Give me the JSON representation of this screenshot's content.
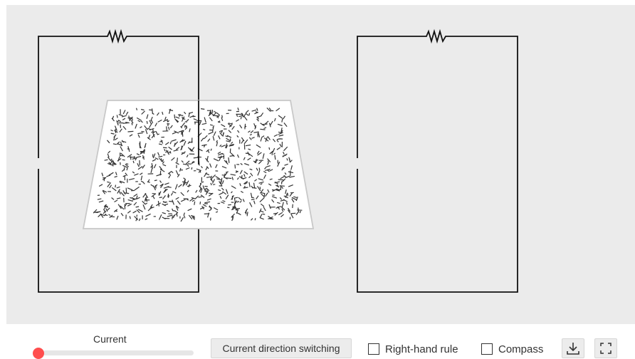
{
  "controls": {
    "current_label": "Current",
    "current_level": 0.0,
    "direction_button": "Current direction switching",
    "right_hand_rule": {
      "label": "Right-hand rule",
      "checked": false
    },
    "compass": {
      "label": "Compass",
      "checked": false
    }
  },
  "colors": {
    "stage_background": "#ebebeb",
    "wire": "#111111",
    "filings": "#333333",
    "slider_thumb": "#ff4d4d"
  },
  "icons": [
    "resistor-icon",
    "download-icon",
    "fullscreen-icon"
  ]
}
